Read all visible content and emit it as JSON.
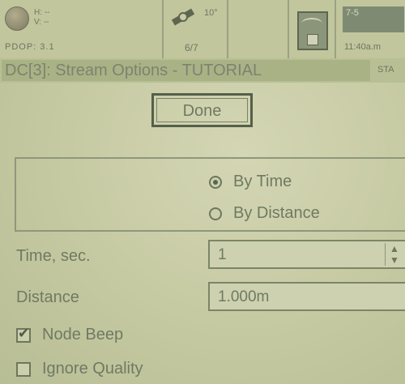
{
  "status_bar": {
    "gps": {
      "horizontal": "H: --",
      "vertical": "V: --",
      "pdop": "PDOP: 3.1"
    },
    "satellites": {
      "tilt": "10°",
      "count": "6/7"
    },
    "radio": {
      "label": "7-5"
    },
    "clock": {
      "time": "11:40a.m"
    }
  },
  "title_bar": {
    "title": "DC[3]: Stream Options - TUTORIAL",
    "tag": "STA"
  },
  "buttons": {
    "done": "Done"
  },
  "stream_mode": {
    "options": [
      {
        "label": "By Time",
        "selected": true
      },
      {
        "label": "By Distance",
        "selected": false
      }
    ]
  },
  "fields": {
    "time": {
      "label": "Time, sec.",
      "value": "1"
    },
    "distance": {
      "label": "Distance",
      "value": "1.000m"
    }
  },
  "checkboxes": {
    "node_beep": {
      "label": "Node Beep",
      "checked": true
    },
    "ignore_quality": {
      "label": "Ignore Quality",
      "checked": false
    }
  },
  "icons": {
    "gps": "gps-status-icon",
    "satellite": "satellite-icon",
    "storage": "storage-icon"
  }
}
